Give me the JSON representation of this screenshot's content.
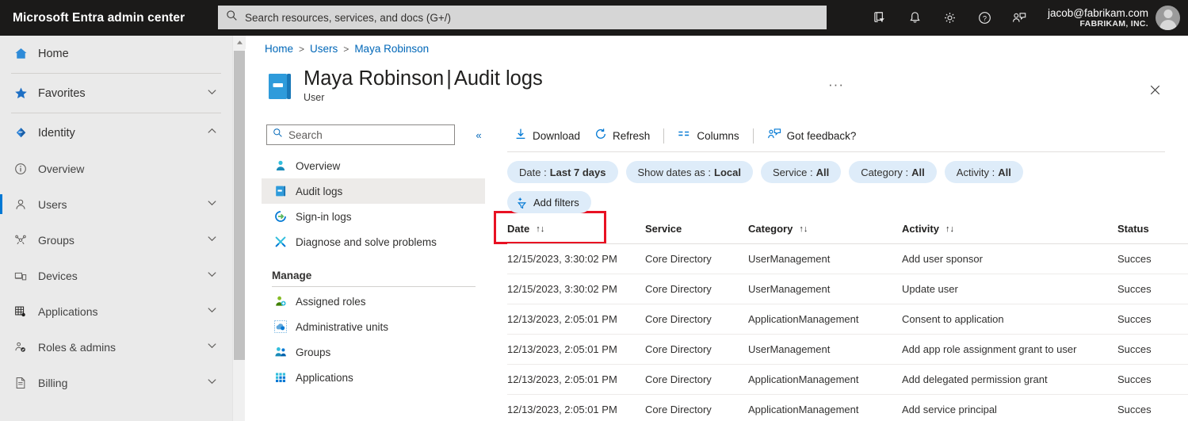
{
  "topbar": {
    "brand": "Microsoft Entra admin center",
    "search_placeholder": "Search resources, services, and docs (G+/)",
    "icons": [
      "directories-filter-icon",
      "notifications-bell-icon",
      "settings-gear-icon",
      "help-question-icon",
      "feedback-person-icon"
    ],
    "account": {
      "email": "jacob@fabrikam.com",
      "org": "FABRIKAM, INC."
    }
  },
  "leftnav": {
    "items": [
      {
        "label": "Home",
        "icon": "home-icon",
        "chevron": "",
        "selected": false
      },
      {
        "label": "Favorites",
        "icon": "star-icon",
        "chevron": "v",
        "selected": false
      },
      {
        "label": "Identity",
        "icon": "identity-diamond-icon",
        "chevron": "^",
        "selected": false
      },
      {
        "label": "Overview",
        "icon": "info-circle-icon",
        "chevron": "",
        "selected": false
      },
      {
        "label": "Users",
        "icon": "user-icon",
        "chevron": "v",
        "selected": true
      },
      {
        "label": "Groups",
        "icon": "groups-icon",
        "chevron": "v",
        "selected": false
      },
      {
        "label": "Devices",
        "icon": "devices-icon",
        "chevron": "v",
        "selected": false
      },
      {
        "label": "Applications",
        "icon": "applications-grid-icon",
        "chevron": "v",
        "selected": false
      },
      {
        "label": "Roles & admins",
        "icon": "roles-admins-icon",
        "chevron": "v",
        "selected": false
      },
      {
        "label": "Billing",
        "icon": "billing-document-icon",
        "chevron": "v",
        "selected": false
      }
    ]
  },
  "blade": {
    "breadcrumb": [
      "Home",
      "Users",
      "Maya Robinson"
    ],
    "breadcrumb_separator": ">",
    "title_name": "Maya Robinson",
    "title_divider": "|",
    "title_section": "Audit logs",
    "subtitle": "User",
    "ellipsis": "···",
    "close_label": "✕"
  },
  "resource_menu": {
    "search_placeholder": "Search",
    "collapse_label": "«",
    "items": [
      {
        "label": "Overview",
        "icon": "user-overview-icon",
        "active": false
      },
      {
        "label": "Audit logs",
        "icon": "audit-logs-book-icon",
        "active": true
      },
      {
        "label": "Sign-in logs",
        "icon": "sign-in-logs-icon",
        "active": false
      },
      {
        "label": "Diagnose and solve problems",
        "icon": "diagnose-tools-icon",
        "active": false
      }
    ],
    "group_label": "Manage",
    "manage_items": [
      {
        "label": "Assigned roles",
        "icon": "assigned-roles-icon",
        "active": false
      },
      {
        "label": "Administrative units",
        "icon": "administrative-units-icon",
        "active": false
      },
      {
        "label": "Groups",
        "icon": "groups-people-icon",
        "active": false
      },
      {
        "label": "Applications",
        "icon": "applications-grid-icon",
        "active": false
      }
    ]
  },
  "command_bar": {
    "download": "Download",
    "refresh": "Refresh",
    "columns": "Columns",
    "feedback": "Got feedback?"
  },
  "filters": {
    "pills": [
      {
        "label": "Date :",
        "value": "Last 7 days"
      },
      {
        "label": "Show dates as :",
        "value": "Local"
      },
      {
        "label": "Service :",
        "value": "All"
      },
      {
        "label": "Category :",
        "value": "All"
      },
      {
        "label": "Activity :",
        "value": "All"
      }
    ],
    "add_filters": "Add filters"
  },
  "table": {
    "columns": [
      {
        "label": "Date",
        "sortable": true
      },
      {
        "label": "Service",
        "sortable": false
      },
      {
        "label": "Category",
        "sortable": true
      },
      {
        "label": "Activity",
        "sortable": true
      },
      {
        "label": "Status",
        "sortable": false
      }
    ],
    "sort_glyph": "↑↓",
    "rows": [
      {
        "date": "12/15/2023, 3:30:02 PM",
        "service": "Core Directory",
        "category": "UserManagement",
        "activity": "Add user sponsor",
        "status": "Succes"
      },
      {
        "date": "12/15/2023, 3:30:02 PM",
        "service": "Core Directory",
        "category": "UserManagement",
        "activity": "Update user",
        "status": "Succes"
      },
      {
        "date": "12/13/2023, 2:05:01 PM",
        "service": "Core Directory",
        "category": "ApplicationManagement",
        "activity": "Consent to application",
        "status": "Succes"
      },
      {
        "date": "12/13/2023, 2:05:01 PM",
        "service": "Core Directory",
        "category": "UserManagement",
        "activity": "Add app role assignment grant to user",
        "status": "Succes"
      },
      {
        "date": "12/13/2023, 2:05:01 PM",
        "service": "Core Directory",
        "category": "ApplicationManagement",
        "activity": "Add delegated permission grant",
        "status": "Succes"
      },
      {
        "date": "12/13/2023, 2:05:01 PM",
        "service": "Core Directory",
        "category": "ApplicationManagement",
        "activity": "Add service principal",
        "status": "Succes"
      }
    ]
  },
  "colors": {
    "topbar_bg": "#1b1a19",
    "nav_bg": "#eaeaea",
    "accent_blue": "#0078d4",
    "link_blue": "#0067b8",
    "pill_bg": "#deecf9",
    "highlight_red": "#e81123",
    "active_row": "#edebe9"
  }
}
